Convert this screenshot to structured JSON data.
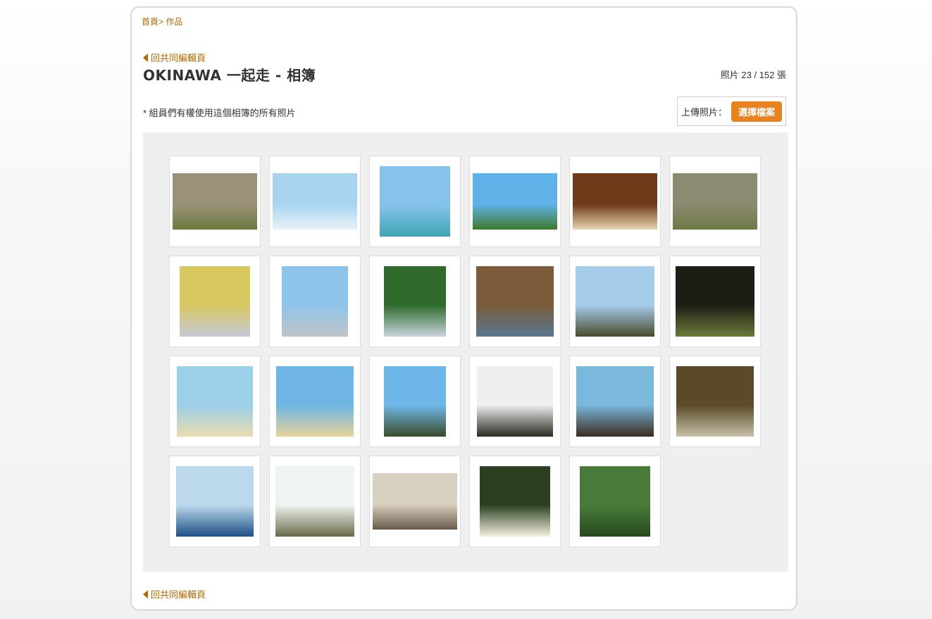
{
  "breadcrumb": {
    "home": "首頁",
    "separator": ">",
    "current": "作品"
  },
  "back_link": {
    "label": "回共同編輯頁"
  },
  "album": {
    "title": "OKINAWA 一起走 - 相簿",
    "photo_count": "照片 23 / 152 張"
  },
  "note": "* 組員們有權使用這個相簿的所有照片",
  "upload": {
    "label": "上傳照片：",
    "button": "選擇檔案"
  },
  "photos": [
    {
      "w": 120,
      "h": 80,
      "sky": "#9a9278",
      "ground": "#6b7a3e"
    },
    {
      "w": 120,
      "h": 80,
      "sky": "#a9d4f0",
      "ground": "#e9f2f6"
    },
    {
      "w": 100,
      "h": 100,
      "sky": "#86c3ea",
      "ground": "#3fa4b4"
    },
    {
      "w": 120,
      "h": 80,
      "sky": "#5fb3e8",
      "ground": "#3e7a2a"
    },
    {
      "w": 120,
      "h": 80,
      "sky": "#6e3a1a",
      "ground": "#e8d4b0"
    },
    {
      "w": 120,
      "h": 80,
      "sky": "#8c8a70",
      "ground": "#6d7a46"
    },
    {
      "w": 100,
      "h": 100,
      "sky": "#d8c860",
      "ground": "#c8c8d8"
    },
    {
      "w": 94,
      "h": 100,
      "sky": "#8fc4ea",
      "ground": "#c0c4c8"
    },
    {
      "w": 88,
      "h": 100,
      "sky": "#2f6a2c",
      "ground": "#c8d4dc"
    },
    {
      "w": 110,
      "h": 100,
      "sky": "#7a5c3a",
      "ground": "#5a7690"
    },
    {
      "w": 112,
      "h": 100,
      "sky": "#a6cceb",
      "ground": "#4a4c2c"
    },
    {
      "w": 112,
      "h": 100,
      "sky": "#1c1e14",
      "ground": "#6b7a3a"
    },
    {
      "w": 108,
      "h": 100,
      "sky": "#9ccfe8",
      "ground": "#e8dcb0"
    },
    {
      "w": 110,
      "h": 100,
      "sky": "#6fb6e4",
      "ground": "#e6d49a"
    },
    {
      "w": 88,
      "h": 100,
      "sky": "#6db8e8",
      "ground": "#3c4c2c"
    },
    {
      "w": 108,
      "h": 100,
      "sky": "#eef0f0",
      "ground": "#2a2a20"
    },
    {
      "w": 110,
      "h": 100,
      "sky": "#7ab8dc",
      "ground": "#3a2c20"
    },
    {
      "w": 110,
      "h": 100,
      "sky": "#5a4a2a",
      "ground": "#c8c0a8"
    },
    {
      "w": 110,
      "h": 100,
      "sky": "#bcd8ec",
      "ground": "#1e4f86"
    },
    {
      "w": 112,
      "h": 100,
      "sky": "#eef4f0",
      "ground": "#6a6a4a"
    },
    {
      "w": 120,
      "h": 80,
      "sky": "#d8d0c0",
      "ground": "#6a5a4a"
    },
    {
      "w": 100,
      "h": 100,
      "sky": "#2a4020",
      "ground": "#f4f0e0"
    },
    {
      "w": 100,
      "h": 100,
      "sky": "#4a7a3a",
      "ground": "#26481e"
    }
  ],
  "grid": {
    "columns": 6
  }
}
